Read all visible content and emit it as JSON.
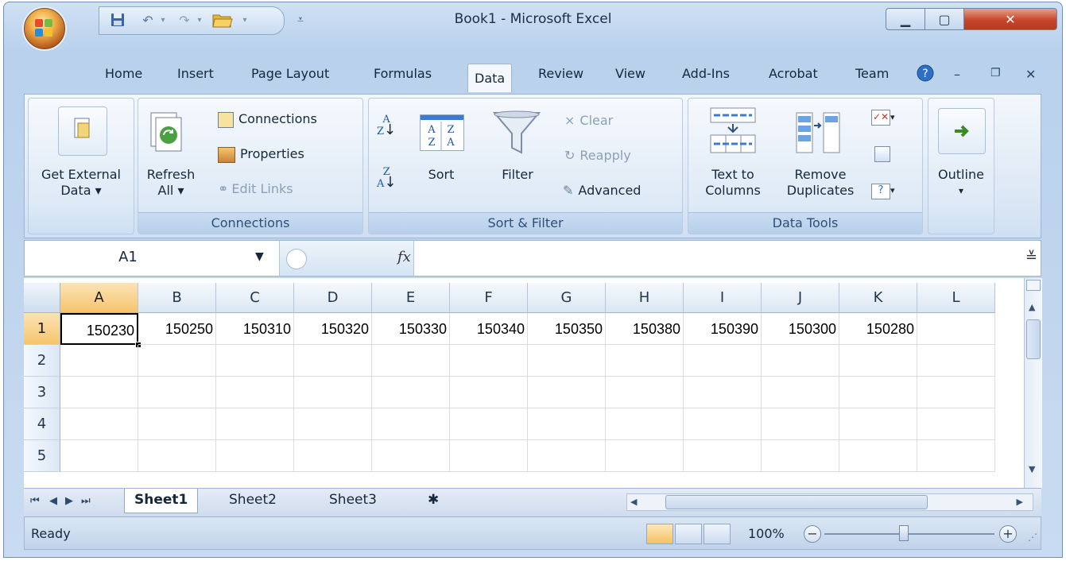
{
  "window": {
    "title": "Book1 - Microsoft Excel"
  },
  "tabs": [
    "Home",
    "Insert",
    "Page Layout",
    "Formulas",
    "Data",
    "Review",
    "View",
    "Add-Ins",
    "Acrobat",
    "Team"
  ],
  "active_tab": "Data",
  "ribbon": {
    "get_external_data": {
      "line1": "Get External",
      "line2": "Data ▾"
    },
    "connections_group": {
      "refresh_line1": "Refresh",
      "refresh_line2": "All ▾",
      "connections": "Connections",
      "properties": "Properties",
      "edit_links": "Edit Links",
      "label": "Connections"
    },
    "sort_filter_group": {
      "sort": "Sort",
      "filter": "Filter",
      "clear": "Clear",
      "reapply": "Reapply",
      "advanced": "Advanced",
      "label": "Sort & Filter"
    },
    "data_tools_group": {
      "text_to_columns_line1": "Text to",
      "text_to_columns_line2": "Columns",
      "remove_duplicates_line1": "Remove",
      "remove_duplicates_line2": "Duplicates",
      "label": "Data Tools"
    },
    "outline": {
      "label": "Outline",
      "arrow": "▾"
    }
  },
  "formula_bar": {
    "name_box": "A1",
    "fx": "fx",
    "value": ""
  },
  "sheet": {
    "columns": [
      "A",
      "B",
      "C",
      "D",
      "E",
      "F",
      "G",
      "H",
      "I",
      "J",
      "K",
      "L"
    ],
    "rows": [
      "1",
      "2",
      "3",
      "4",
      "5"
    ],
    "row1_values": [
      "150230",
      "150250",
      "150310",
      "150320",
      "150330",
      "150340",
      "150350",
      "150380",
      "150390",
      "150300",
      "150280",
      ""
    ],
    "active_cell": "A1"
  },
  "sheet_tabs": [
    "Sheet1",
    "Sheet2",
    "Sheet3"
  ],
  "active_sheet": "Sheet1",
  "status_bar": {
    "ready": "Ready",
    "zoom": "100%"
  },
  "colors": {
    "accent_orange": "#f6c56c",
    "frame_blue": "#b9d1ec",
    "close_red": "#c6452a"
  }
}
